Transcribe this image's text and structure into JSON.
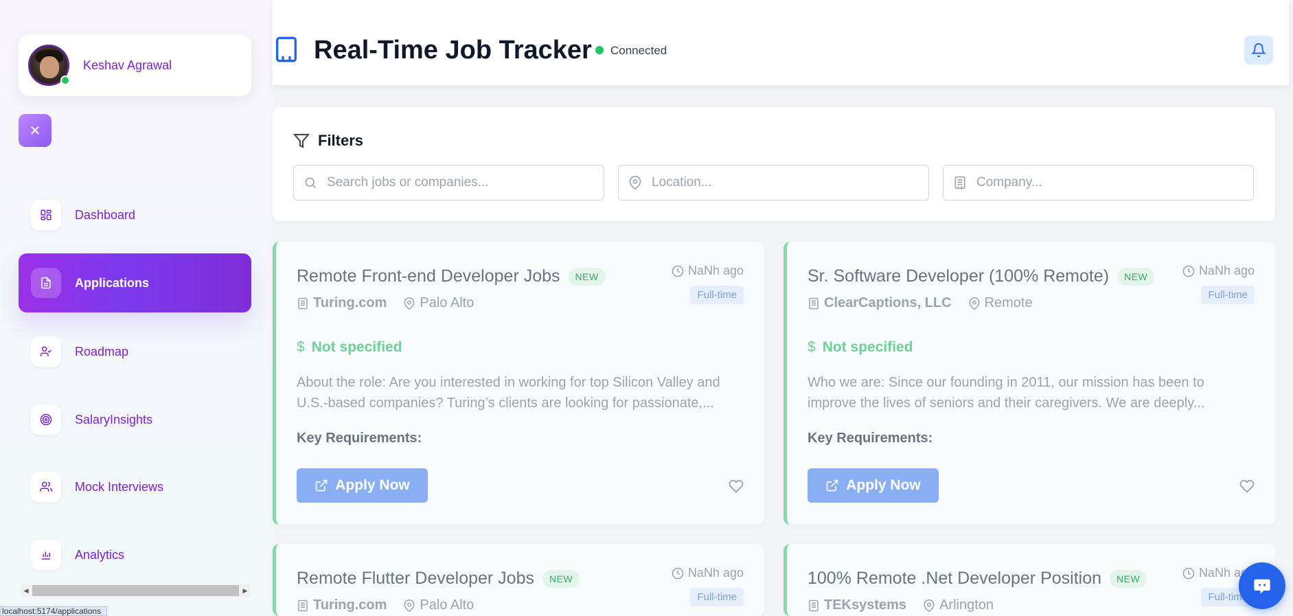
{
  "user": {
    "name": "Keshav Agrawal"
  },
  "nav": {
    "items": [
      {
        "label": "Dashboard",
        "icon": "dashboard-grid-icon",
        "active": false
      },
      {
        "label": "Applications",
        "icon": "document-icon",
        "active": true
      },
      {
        "label": "Roadmap",
        "icon": "user-check-icon",
        "active": false
      },
      {
        "label": "SalaryInsights",
        "icon": "target-icon",
        "active": false
      },
      {
        "label": "Mock Interviews",
        "icon": "users-icon",
        "active": false
      },
      {
        "label": "Analytics",
        "icon": "bar-chart-icon",
        "active": false
      }
    ]
  },
  "status_bar": {
    "url": "localhost:5174/applications"
  },
  "header": {
    "title": "Real-Time Job Tracker",
    "connection": "Connected",
    "colors": {
      "connected": "#22c55e",
      "accent": "#7c3aed"
    }
  },
  "filters": {
    "title": "Filters",
    "search_placeholder": "Search jobs or companies...",
    "location_placeholder": "Location...",
    "company_placeholder": "Company..."
  },
  "jobs": [
    {
      "title": "Remote Front-end Developer Jobs",
      "badge": "NEW",
      "time": "NaNh ago",
      "type": "Full-time",
      "company": "Turing.com",
      "location": "Palo Alto",
      "salary": "Not specified",
      "description": "About the role: Are you interested in working for top Silicon Valley and U.S.-based companies? Turing’s clients are looking for passionate,...",
      "requirements_label": "Key Requirements:",
      "apply_label": "Apply Now"
    },
    {
      "title": "Sr. Software Developer (100% Remote)",
      "badge": "NEW",
      "time": "NaNh ago",
      "type": "Full-time",
      "company": "ClearCaptions, LLC",
      "location": "Remote",
      "salary": "Not specified",
      "description": "Who we are: Since our founding in 2011, our mission has been to improve the lives of seniors and their caregivers. We are deeply...",
      "requirements_label": "Key Requirements:",
      "apply_label": "Apply Now"
    },
    {
      "title": "Remote Flutter Developer Jobs",
      "badge": "NEW",
      "time": "NaNh ago",
      "type": "Full-time",
      "company": "Turing.com",
      "location": "Palo Alto"
    },
    {
      "title": "100% Remote .Net Developer Position",
      "badge": "NEW",
      "time": "NaNh ago",
      "type": "Full-time",
      "company": "TEKsystems",
      "location": "Arlington"
    }
  ]
}
